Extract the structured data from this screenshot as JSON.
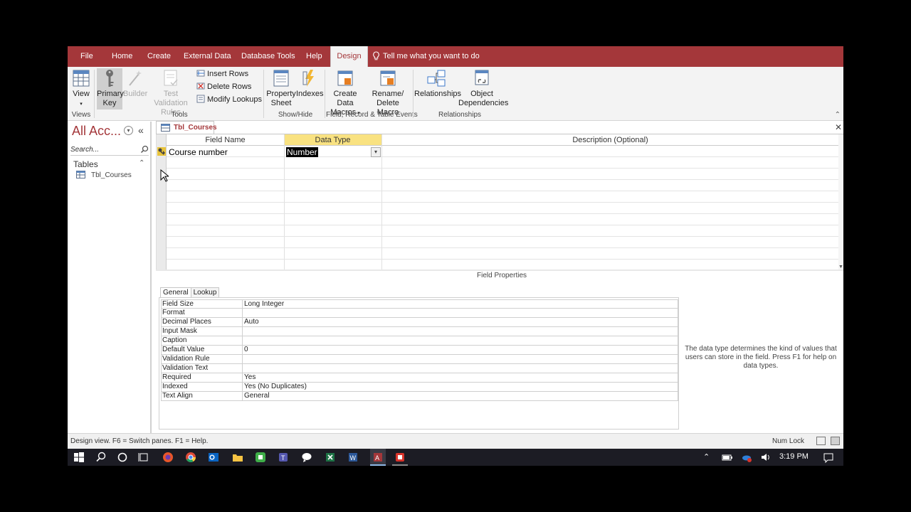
{
  "ribbon_tabs": [
    "File",
    "Home",
    "Create",
    "External Data",
    "Database Tools",
    "Help",
    "Design"
  ],
  "active_tab": "Design",
  "tell_me": "Tell me what you want to do",
  "ribbon": {
    "view_label": "View",
    "primary_key_label": "Primary Key",
    "builder_label": "Builder",
    "test_validation_label": "Test Validation Rules",
    "insert_rows": "Insert Rows",
    "delete_rows": "Delete Rows",
    "modify_lookups": "Modify Lookups",
    "property_sheet_label": "Property Sheet",
    "indexes_label": "Indexes",
    "create_data_macros_label": "Create Data Macros",
    "rename_delete_macro_label": "Rename/ Delete Macro",
    "relationships_label": "Relationships",
    "object_dependencies_label": "Object Dependencies",
    "groups": {
      "views": "Views",
      "tools": "Tools",
      "show_hide": "Show/Hide",
      "field_record_table_events": "Field, Record & Table Events",
      "relationships": "Relationships"
    }
  },
  "nav": {
    "title": "All Acc...",
    "search_placeholder": "Search...",
    "section": "Tables",
    "items": [
      "Tbl_Courses"
    ]
  },
  "document": {
    "tab_label": "Tbl_Courses"
  },
  "design_grid": {
    "headers": [
      "Field Name",
      "Data Type",
      "Description (Optional)"
    ],
    "rows": [
      {
        "field_name": "Course number",
        "data_type": "Number",
        "description": ""
      }
    ]
  },
  "field_properties": {
    "title": "Field Properties",
    "tabs": [
      "General",
      "Lookup"
    ],
    "active_tab": "General",
    "rows": [
      {
        "label": "Field Size",
        "value": "Long Integer"
      },
      {
        "label": "Format",
        "value": ""
      },
      {
        "label": "Decimal Places",
        "value": "Auto"
      },
      {
        "label": "Input Mask",
        "value": ""
      },
      {
        "label": "Caption",
        "value": ""
      },
      {
        "label": "Default Value",
        "value": "0"
      },
      {
        "label": "Validation Rule",
        "value": ""
      },
      {
        "label": "Validation Text",
        "value": ""
      },
      {
        "label": "Required",
        "value": "Yes"
      },
      {
        "label": "Indexed",
        "value": "Yes (No Duplicates)"
      },
      {
        "label": "Text Align",
        "value": "General"
      }
    ],
    "help_text": "The data type determines the kind of values that users can store in the field. Press F1 for help on data types."
  },
  "status_bar": {
    "text": "Design view.  F6 = Switch panes.  F1 = Help.",
    "num_lock": "Num Lock"
  },
  "taskbar": {
    "time": "3:19 PM",
    "apps": [
      "start-icon",
      "search-icon",
      "cortana-icon",
      "task-view-icon",
      "firefox-icon",
      "chrome-icon",
      "outlook-icon",
      "file-explorer-icon",
      "camtasia-icon",
      "teams-icon",
      "messenger-icon",
      "excel-icon",
      "word-icon",
      "access-icon",
      "recorder-icon"
    ]
  },
  "colors": {
    "accent": "#a4373a",
    "selected_header": "#f9e281",
    "taskbar": "#1c1c24"
  }
}
